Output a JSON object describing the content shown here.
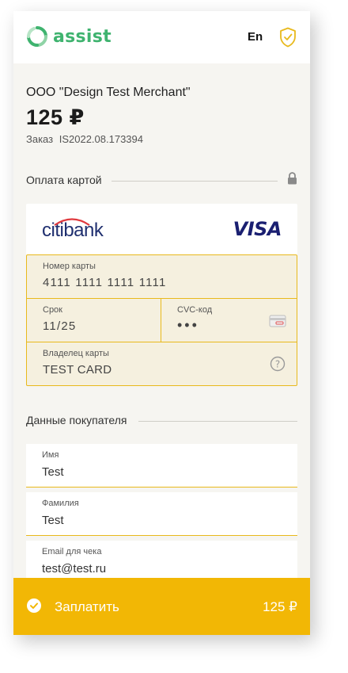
{
  "header": {
    "logo_text": "assist",
    "language": "En",
    "shield_icon": "shield-check-icon"
  },
  "order": {
    "merchant": "ООО \"Design Test Merchant\"",
    "amount": "125 ₽",
    "order_label": "Заказ",
    "order_number": "IS2022.08.173394"
  },
  "card_section": {
    "title": "Оплата картой",
    "lock_icon": "lock-icon",
    "bank_name": "citibank",
    "network": "VISA",
    "number_label": "Номер карты",
    "number_value": "4111 1111 1111 1111",
    "expiry_label": "Срок",
    "expiry_value": "11/25",
    "cvc_label": "CVC-код",
    "cvc_value": "•••",
    "holder_label": "Владелец карты",
    "holder_value": "TEST CARD"
  },
  "buyer_section": {
    "title": "Данные покупателя",
    "fields": [
      {
        "label": "Имя",
        "value": "Test"
      },
      {
        "label": "Фамилия",
        "value": "Test"
      },
      {
        "label": "Email для чека",
        "value": "test@test.ru"
      }
    ]
  },
  "pay_button": {
    "label": "Заплатить",
    "amount": "125 ₽"
  },
  "colors": {
    "accent": "#f2b705",
    "brand_green": "#3fb36f",
    "background": "#f6f5f1",
    "card_field_bg": "#f5f0df"
  }
}
